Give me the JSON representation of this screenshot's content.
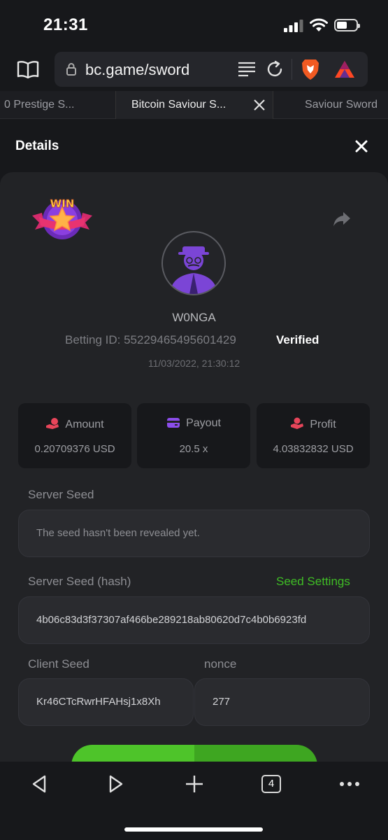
{
  "status_bar": {
    "time": "21:31"
  },
  "browser": {
    "url": "bc.game/sword",
    "tabs": [
      {
        "label": "0 Prestige S..."
      },
      {
        "label": "Bitcoin Saviour S..."
      },
      {
        "label": "Saviour Sword"
      }
    ],
    "tab_count": "4"
  },
  "details": {
    "title": "Details",
    "badge_text": "WIN",
    "username": "W0NGA",
    "betting_id": "Betting ID: 55229465495601429",
    "verified": "Verified",
    "datetime": "11/03/2022, 21:30:12",
    "stats": [
      {
        "label": "Amount",
        "value": "0.20709376 USD",
        "icon": "coins-hand-icon",
        "color": "#e8455a"
      },
      {
        "label": "Payout",
        "value": "20.5 x",
        "icon": "wallet-icon",
        "color": "#8b4dea"
      },
      {
        "label": "Profit",
        "value": "4.03832832 USD",
        "icon": "hand-coin-icon",
        "color": "#e8455a"
      }
    ],
    "server_seed_label": "Server Seed",
    "server_seed_value": "The seed hasn't been revealed yet.",
    "server_seed_hash_label": "Server Seed (hash)",
    "seed_settings_label": "Seed Settings",
    "server_seed_hash_value": "4b06c83d3f37307af466be289218ab80620d7c4b0b6923fd",
    "client_seed_label": "Client Seed",
    "client_seed_value": "Kr46CTcRwrHFAHsj1x8Xh",
    "nonce_label": "nonce",
    "nonce_value": "277"
  },
  "colors": {
    "accent_green": "#3fbd25",
    "button_green": "#4ec42a"
  }
}
